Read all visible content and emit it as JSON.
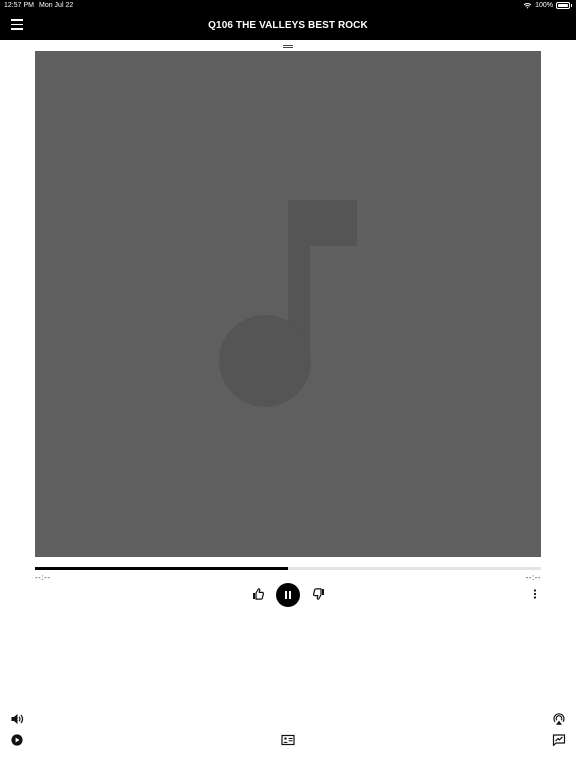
{
  "status_bar": {
    "time": "12:57 PM",
    "date": "Mon Jul 22",
    "battery": "100%",
    "icons": [
      "wifi-icon",
      "battery-icon"
    ]
  },
  "header": {
    "title": "Q106 THE VALLEYS BEST ROCK",
    "menu_icon": "hamburger-menu-icon"
  },
  "player": {
    "artwork_icon": "music-note-icon",
    "progress_fraction": 0.5,
    "elapsed": "--:--",
    "remaining": "--:--",
    "controls": {
      "thumb_up_icon": "thumb-up-icon",
      "play_pause_icon": "pause-icon",
      "thumb_down_icon": "thumb-down-icon",
      "more_icon": "more-vertical-icon"
    }
  },
  "bottom_bar": {
    "left": [
      "volume-icon",
      "play-circle-icon"
    ],
    "center": [
      "media-card-icon"
    ],
    "right": [
      "airplay-icon",
      "lyrics-icon"
    ]
  },
  "colors": {
    "header_bg": "#000000",
    "artwork_bg": "#5f5f5f",
    "note_color": "#555555",
    "progress_fill": "#000000",
    "progress_track": "#e4e4e4"
  }
}
